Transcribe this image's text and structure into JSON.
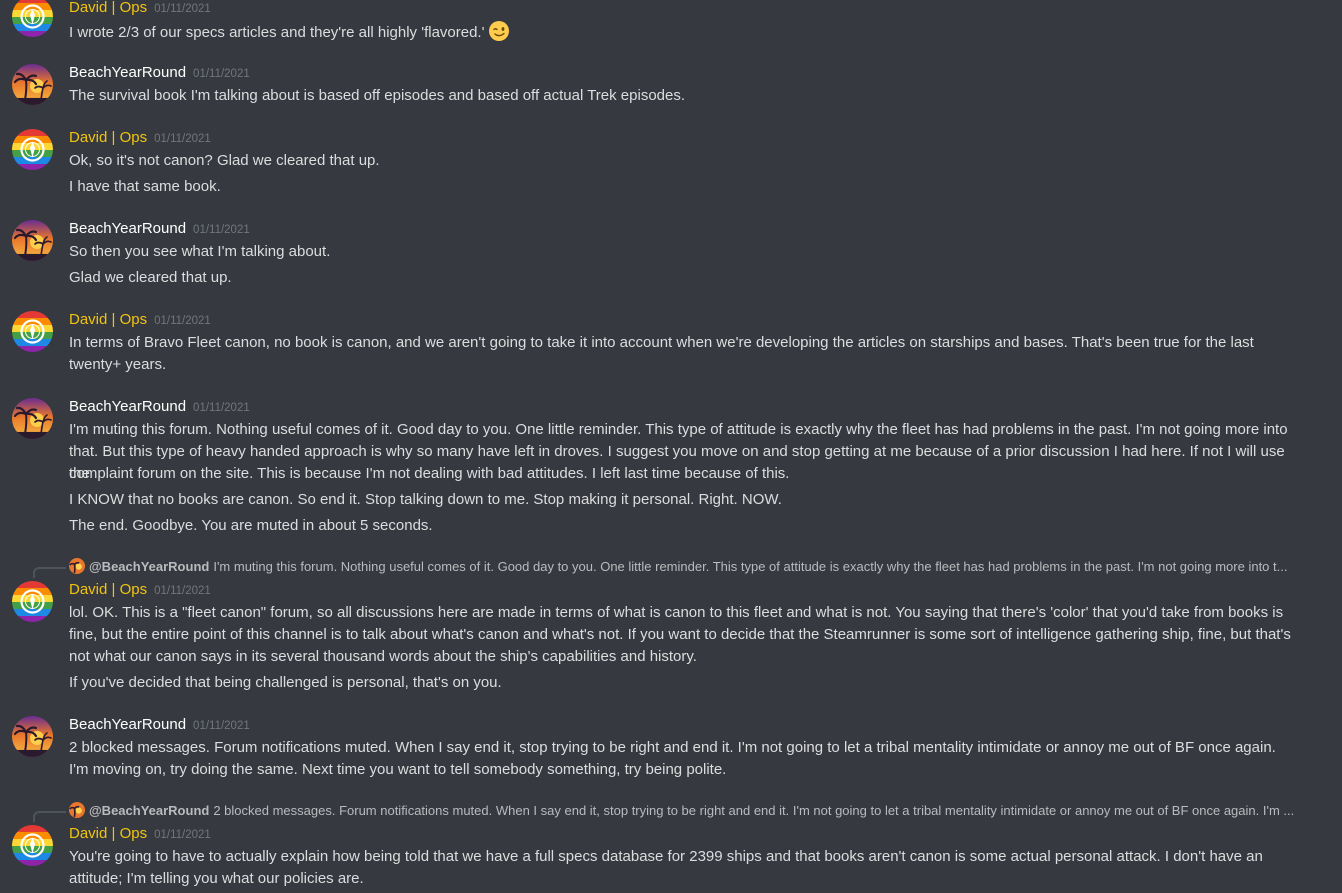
{
  "authors": {
    "david": "David | Ops",
    "beach": "BeachYearRound"
  },
  "colors": {
    "background": "#36393f",
    "david_name": "#f1c40f",
    "beach_name": "#ffffff",
    "message_text": "#dcddde",
    "timestamp": "#72767d"
  },
  "messages": [
    {
      "author": "David | Ops",
      "timestamp": "01/11/2021",
      "lines": [
        "I wrote 2/3 of our specs articles and they're all highly 'flavored.'"
      ],
      "emoji": "winking-face-emoji"
    },
    {
      "author": "BeachYearRound",
      "timestamp": "01/11/2021",
      "lines": [
        "The survival book I'm talking about is based off episodes and based off actual Trek episodes."
      ]
    },
    {
      "author": "David | Ops",
      "timestamp": "01/11/2021",
      "lines": [
        "Ok, so it's not canon? Glad we cleared that up.",
        "I have that same book."
      ]
    },
    {
      "author": "BeachYearRound",
      "timestamp": "01/11/2021",
      "lines": [
        "So then you see what I'm talking about.",
        "Glad we cleared that up."
      ]
    },
    {
      "author": "David | Ops",
      "timestamp": "01/11/2021",
      "lines": [
        "In terms of Bravo Fleet canon, no book is canon, and we aren't going to take it into account when we're developing the articles on starships and bases. That's been true for the last",
        "twenty+ years."
      ]
    },
    {
      "author": "BeachYearRound",
      "timestamp": "01/11/2021",
      "lines": [
        "I'm muting this forum. Nothing useful comes of it. Good day to you. One little reminder. This type of attitude is exactly why the fleet has had problems in the past. I'm not going more into",
        "that. But this type of heavy handed approach is why so many have left in droves. I suggest you move on and stop getting at me because of a prior discussion I had here. If not I will use the",
        "complaint forum on the site. This is because I'm not dealing with bad attitudes. I left last time because of this.",
        "I KNOW that no books are canon. So end it. Stop talking down to me. Stop making it personal. Right. NOW.",
        "The end. Goodbye. You are muted in about 5 seconds."
      ]
    },
    {
      "reply": {
        "mention": "@BeachYearRound",
        "text": "I'm muting this forum. Nothing useful comes of it. Good day to you. One little reminder. This type of attitude is exactly why the fleet has had problems in the past. I'm not going more into t..."
      },
      "author": "David | Ops",
      "timestamp": "01/11/2021",
      "lines": [
        "lol. OK. This is a \"fleet canon\" forum, so all discussions here are made in terms of what is canon to this fleet and what is not. You saying that there's 'color' that you'd take from books is",
        "fine, but the entire point of this channel is to talk about what's canon and what's not. If you want to decide that the Steamrunner is some sort of intelligence gathering ship, fine, but that's",
        "not what our canon says in its several thousand words about  the ship's capabilities and history.",
        "If you've decided that being challenged is personal, that's on you."
      ]
    },
    {
      "author": "BeachYearRound",
      "timestamp": "01/11/2021",
      "lines": [
        "2 blocked messages. Forum notifications muted. When I say end it, stop trying to be right and end it. I'm not going to let a tribal mentality intimidate or annoy me out of BF once again.",
        "I'm moving on, try doing the same. Next time you want to tell somebody something, try being polite."
      ]
    },
    {
      "reply": {
        "mention": "@BeachYearRound",
        "text": "2 blocked messages. Forum notifications muted. When I say end it, stop trying to be right and end it. I'm not going to let a tribal mentality intimidate or annoy me out of BF once again. I'm ..."
      },
      "author": "David | Ops",
      "timestamp": "01/11/2021",
      "lines": [
        "You're going to have to actually explain how being told that we have a full specs database for 2399 ships and that books aren't canon is some actual personal attack. I don't have an",
        "attitude; I'm telling you what our policies are."
      ]
    }
  ]
}
